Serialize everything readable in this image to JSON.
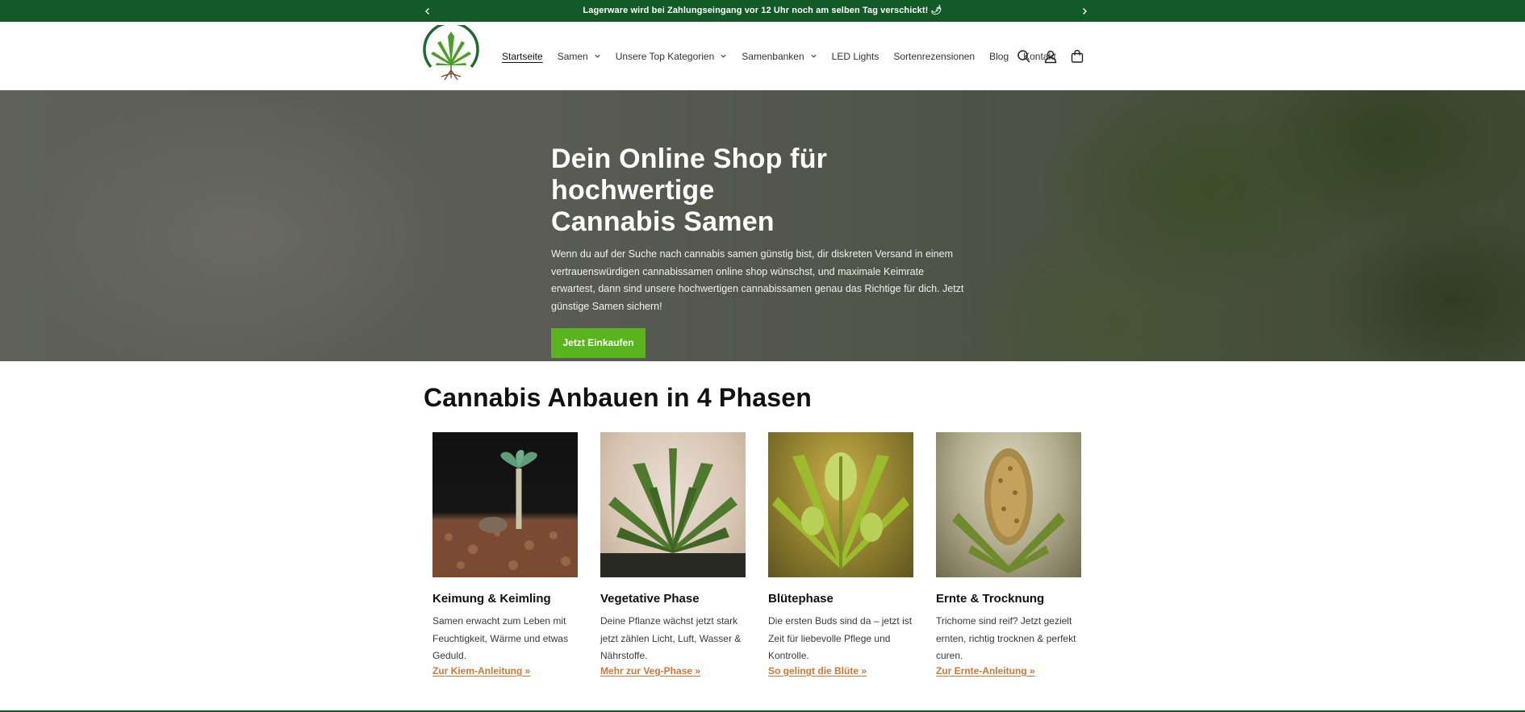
{
  "announcement": {
    "text": "Lagerware wird bei Zahlungseingang vor 12 Uhr noch am selben Tag verschickt! 🌶"
  },
  "nav": {
    "items": [
      {
        "label": "Startseite",
        "dropdown": false,
        "active": true
      },
      {
        "label": "Samen",
        "dropdown": true
      },
      {
        "label": "Unsere Top Kategorien",
        "dropdown": true
      },
      {
        "label": "Samenbanken",
        "dropdown": true
      },
      {
        "label": "LED Lights",
        "dropdown": false
      },
      {
        "label": "Sortenrezensionen",
        "dropdown": false
      },
      {
        "label": "Blog",
        "dropdown": false
      },
      {
        "label": "Kontakt",
        "dropdown": false
      }
    ]
  },
  "hero": {
    "title_line1": "Dein Online Shop für hochwertige",
    "title_line2": "Cannabis Samen",
    "text": "Wenn du auf der Suche nach cannabis samen günstig bist, dir diskreten Versand in einem vertrauenswürdigen cannabissamen online shop wünschst, und maximale Keimrate erwartest, dann sind unsere hochwertigen cannabissamen genau das Richtige für dich. Jetzt günstige Samen sichern!",
    "button_label": "Jetzt Einkaufen"
  },
  "phases": {
    "title": "Cannabis Anbauen in 4 Phasen",
    "cards": [
      {
        "title": "Keimung & Keimling",
        "text": "Samen erwacht zum Leben mit Feuchtigkeit, Wärme und etwas Geduld.",
        "link": "Zur Kiem-Anleitung »"
      },
      {
        "title": "Vegetative Phase",
        "text": "Deine Pflanze wächst jetzt stark jetzt zählen Licht, Luft, Wasser & Nährstoffe.",
        "link": "Mehr zur Veg-Phase »"
      },
      {
        "title": "Blütephase",
        "text": "Die ersten Buds sind da – jetzt ist Zeit für liebevolle Pflege und Kontrolle.",
        "link": "So gelingt die Blüte »"
      },
      {
        "title": "Ernte & Trocknung",
        "text": "Trichome sind reif? Jetzt gezielt ernten, richtig trocknen & perfekt curen.",
        "link": "Zur Ernte-Anleitung »"
      }
    ]
  },
  "colors": {
    "announcement_bg": "#125a28",
    "button_green": "#5ab41e",
    "link_orange": "#c9793a"
  }
}
